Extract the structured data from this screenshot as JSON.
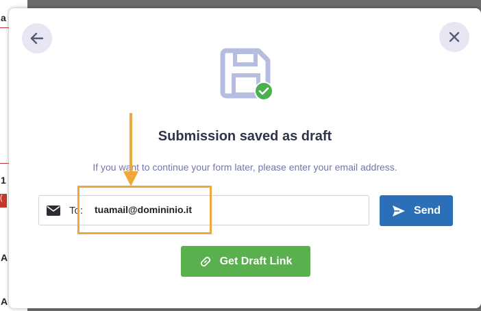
{
  "background": {
    "fragments": [
      "a",
      "1",
      "A",
      "A"
    ],
    "badge": "("
  },
  "modal": {
    "title": "Submission saved as draft",
    "subtitle": "If you want to continue your form later, please enter your email address.",
    "email": {
      "label": "To:",
      "value": "tuamail@domininio.it"
    },
    "send_label": "Send",
    "draft_link_label": "Get Draft Link",
    "icons": {
      "back": "arrow-left-icon",
      "close": "close-icon",
      "saved": "floppy-disk-check-icon",
      "mail": "envelope-icon",
      "send": "paper-plane-icon",
      "link": "link-icon"
    }
  },
  "colors": {
    "send": "#2a6fb8",
    "draft_link": "#5ab04e",
    "annotation": "#f0a63a",
    "check": "#4caf50"
  }
}
